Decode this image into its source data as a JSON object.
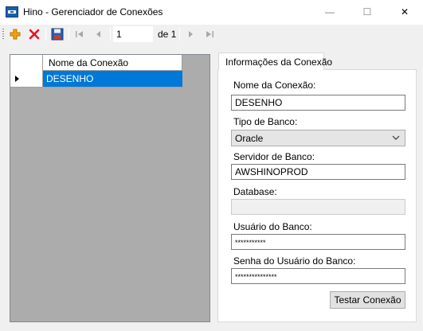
{
  "window": {
    "title": "Hino - Gerenciador de Conexões",
    "minimize": "—",
    "maximize": "☐",
    "close": "✕"
  },
  "toolbar": {
    "add_icon": "plus-icon",
    "delete_icon": "delete-icon",
    "save_icon": "save-icon",
    "position_value": "1",
    "count_text": "de 1"
  },
  "grid": {
    "column_header": "Nome da Conexão",
    "rows": [
      {
        "nome": "DESENHO",
        "selected": true
      }
    ]
  },
  "tab": {
    "label": "Informações da Conexão"
  },
  "form": {
    "nome_label": "Nome da Conexão:",
    "nome_value": "DESENHO",
    "tipo_label": "Tipo de Banco:",
    "tipo_value": "Oracle",
    "servidor_label": "Servidor de Banco:",
    "servidor_value": "AWSHINOPROD",
    "database_label": "Database:",
    "database_value": "",
    "usuario_label": "Usuário do Banco:",
    "usuario_value": "***********",
    "senha_label": "Senha do Usuário do Banco:",
    "senha_value": "***************",
    "test_button": "Testar Conexão"
  },
  "colors": {
    "selection": "#0078d7",
    "delete_red": "#e81123",
    "add_orange": "#f4a300"
  }
}
